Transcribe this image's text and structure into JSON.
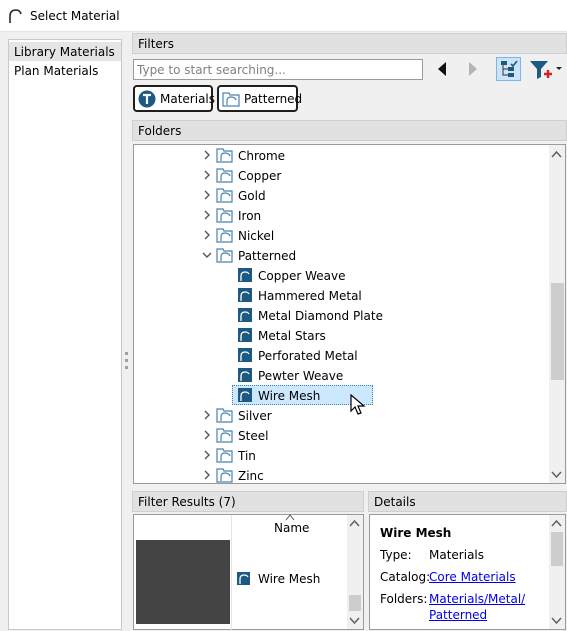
{
  "window": {
    "title": "Select Material"
  },
  "sidebar": {
    "items": [
      {
        "label": "Library Materials",
        "selected": true
      },
      {
        "label": "Plan Materials",
        "selected": false
      }
    ]
  },
  "filters": {
    "header": "Filters",
    "search_placeholder": "Type to start searching...",
    "chips": [
      {
        "label": "Materials"
      },
      {
        "label": "Patterned"
      }
    ]
  },
  "folders": {
    "header": "Folders",
    "rows": [
      {
        "label": "Chrome",
        "type": "folder",
        "expanded": false
      },
      {
        "label": "Copper",
        "type": "folder",
        "expanded": false
      },
      {
        "label": "Gold",
        "type": "folder",
        "expanded": false
      },
      {
        "label": "Iron",
        "type": "folder",
        "expanded": false
      },
      {
        "label": "Nickel",
        "type": "folder",
        "expanded": false
      },
      {
        "label": "Patterned",
        "type": "folder",
        "expanded": true
      },
      {
        "label": "Copper Weave",
        "type": "material"
      },
      {
        "label": "Hammered Metal",
        "type": "material"
      },
      {
        "label": "Metal Diamond Plate",
        "type": "material"
      },
      {
        "label": "Metal Stars",
        "type": "material"
      },
      {
        "label": "Perforated Metal",
        "type": "material"
      },
      {
        "label": "Pewter Weave",
        "type": "material"
      },
      {
        "label": "Wire Mesh",
        "type": "material",
        "selected": true
      },
      {
        "label": "Silver",
        "type": "folder",
        "expanded": false
      },
      {
        "label": "Steel",
        "type": "folder",
        "expanded": false
      },
      {
        "label": "Tin",
        "type": "folder",
        "expanded": false
      },
      {
        "label": "Zinc",
        "type": "folder",
        "expanded": false
      }
    ]
  },
  "filter_results": {
    "header": "Filter Results (7)",
    "column_name": "Name",
    "item": {
      "label": "Wire Mesh",
      "swatch_color": "#444444"
    }
  },
  "details": {
    "header": "Details",
    "title": "Wire Mesh",
    "type_label": "Type:",
    "type_value": "Materials",
    "catalog_label": "Catalog:",
    "catalog_value": "Core Materials",
    "folders_label": "Folders:",
    "folders_value_line1": "Materials/Metal/",
    "folders_value_line2": "Patterned"
  },
  "colors": {
    "accent": "#1c5a84",
    "selection_bg": "#cce8ff",
    "folder_icon": "#4a82ad",
    "link": "#0000ee"
  }
}
